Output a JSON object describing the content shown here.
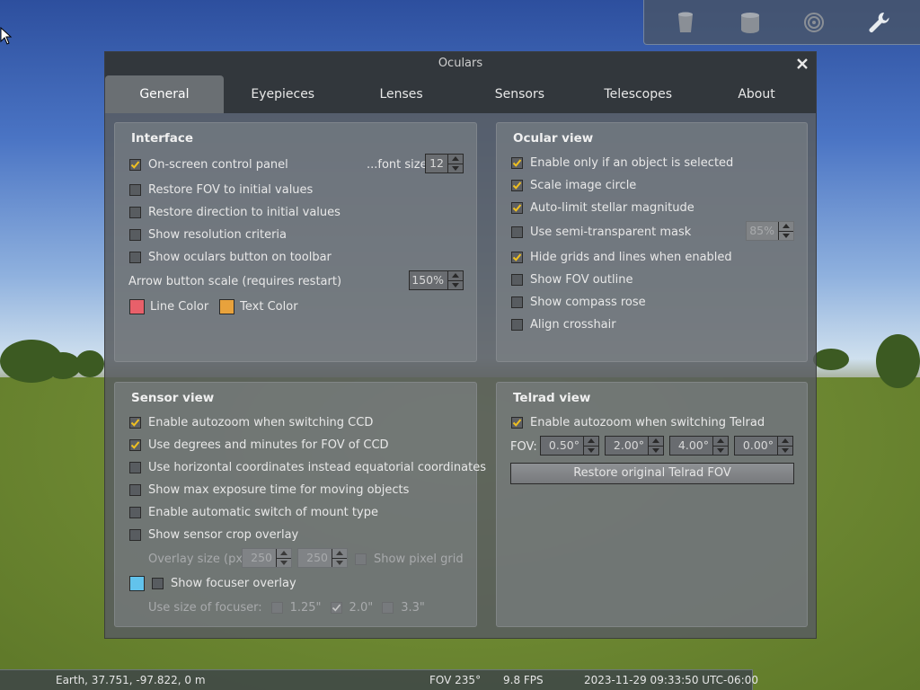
{
  "toolbar": {
    "icons": [
      "bucket-icon",
      "telescope-cup-icon",
      "sensor-icon",
      "wrench-icon"
    ]
  },
  "dialog": {
    "title": "Oculars",
    "close_label": "✕",
    "tabs": [
      "General",
      "Eyepieces",
      "Lenses",
      "Sensors",
      "Telescopes",
      "About"
    ],
    "active_tab": "General"
  },
  "interface": {
    "title": "Interface",
    "onscreen_panel": "On-screen control panel",
    "font_size_label": "...font size",
    "font_size_value": "12",
    "restore_fov": "Restore FOV to initial values",
    "restore_direction": "Restore direction to initial values",
    "show_resolution": "Show resolution criteria",
    "show_oculars_button": "Show oculars button on toolbar",
    "arrow_scale_label": "Arrow button scale (requires restart)",
    "arrow_scale_value": "150%",
    "line_color_label": "Line Color",
    "text_color_label": "Text Color",
    "line_color": "#e8606a",
    "text_color": "#e8a23c"
  },
  "ocular_view": {
    "title": "Ocular view",
    "enable_selected": "Enable only if an object is selected",
    "scale_circle": "Scale image circle",
    "auto_limit": "Auto-limit stellar magnitude",
    "semi_mask": "Use semi-transparent mask",
    "mask_value": "85%",
    "hide_grids": "Hide grids and lines when enabled",
    "fov_outline": "Show FOV outline",
    "compass_rose": "Show compass rose",
    "align_crosshair": "Align crosshair"
  },
  "sensor_view": {
    "title": "Sensor view",
    "autozoom_ccd": "Enable autozoom when switching CCD",
    "degrees_minutes": "Use degrees and minutes for FOV of CCD",
    "horizontal_coords": "Use horizontal coordinates instead equatorial coordinates",
    "max_exposure": "Show max exposure time for moving objects",
    "auto_mount": "Enable automatic switch of mount type",
    "crop_overlay": "Show sensor crop overlay",
    "overlay_size_label": "Overlay size (px)",
    "overlay_w": "250",
    "overlay_h": "250",
    "pixel_grid": "Show pixel grid",
    "focuser_overlay": "Show focuser overlay",
    "focuser_color": "#62c3ec",
    "focuser_size_label": "Use size of focuser:",
    "focuser_sizes": [
      "1.25\"",
      "2.0\"",
      "3.3\""
    ]
  },
  "telrad_view": {
    "title": "Telrad view",
    "autozoom_telrad": "Enable autozoom when switching Telrad",
    "fov_label": "FOV:",
    "fov_values": [
      "0.50°",
      "2.00°",
      "4.00°",
      "0.00°"
    ],
    "restore_button": "Restore original Telrad FOV"
  },
  "status": {
    "location": "Earth, 37.751, -97.822, 0 m",
    "fov": "FOV 235°",
    "fps": "9.8 FPS",
    "datetime": "2023-11-29 09:33:50 UTC-06:00"
  }
}
